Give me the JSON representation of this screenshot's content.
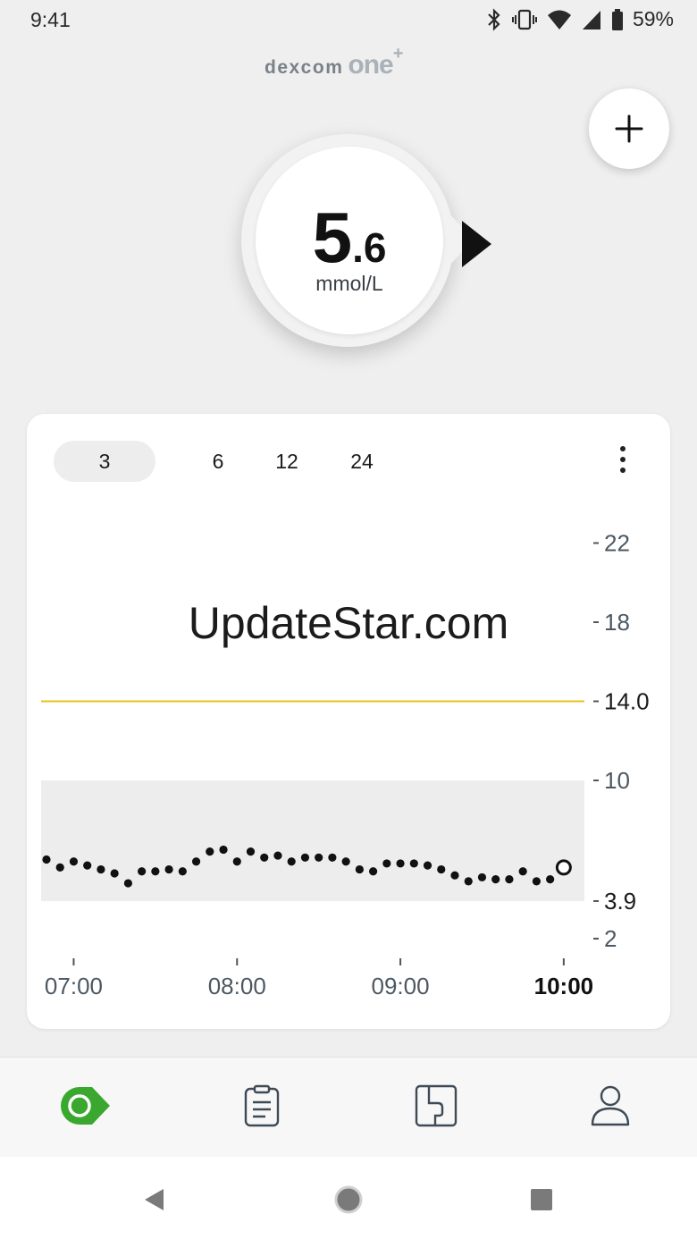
{
  "status_bar": {
    "time": "9:41",
    "battery": "59%",
    "icons": [
      "bluetooth-icon",
      "vibrate-icon",
      "wifi-icon",
      "cell-signal-icon",
      "battery-icon"
    ]
  },
  "logo": {
    "brand": "DEXCOM",
    "product": "one",
    "plus": "+"
  },
  "reading": {
    "integer": "5",
    "decimal": ".6",
    "unit": "mmol/L",
    "trend": "steady-arrow-right"
  },
  "graph": {
    "range_tabs": [
      "3",
      "6",
      "12",
      "24"
    ],
    "selected_range": "3",
    "watermark": "UpdateStar.com"
  },
  "chart_data": {
    "type": "scatter",
    "ylabel": "",
    "xlabel": "",
    "y_tick_labels": [
      "22",
      "18",
      "14.0",
      "10",
      "3.9",
      "2"
    ],
    "x_tick_labels": [
      "07:00",
      "08:00",
      "09:00",
      "10:00"
    ],
    "high_threshold": 14.0,
    "low_threshold": 3.9,
    "target_range": [
      3.9,
      10
    ],
    "xlim": [
      "06:50",
      "10:03"
    ],
    "series": [
      {
        "x": [
          "06:50",
          "06:55",
          "07:00",
          "07:05",
          "07:10",
          "07:15",
          "07:20",
          "07:25",
          "07:30",
          "07:35",
          "07:40",
          "07:45",
          "07:50",
          "07:55",
          "08:00",
          "08:05",
          "08:10",
          "08:15",
          "08:20",
          "08:25",
          "08:30",
          "08:35",
          "08:40",
          "08:45",
          "08:50",
          "08:55",
          "09:00",
          "09:05",
          "09:10",
          "09:15",
          "09:20",
          "09:25",
          "09:30",
          "09:35",
          "09:40",
          "09:45",
          "09:50",
          "09:55",
          "10:00"
        ],
        "y": [
          6.0,
          5.6,
          5.9,
          5.7,
          5.5,
          5.3,
          4.8,
          5.4,
          5.4,
          5.5,
          5.4,
          5.9,
          6.4,
          6.5,
          5.9,
          6.4,
          6.1,
          6.2,
          5.9,
          6.1,
          6.1,
          6.1,
          5.9,
          5.5,
          5.4,
          5.8,
          5.8,
          5.8,
          5.7,
          5.5,
          5.2,
          4.9,
          5.1,
          5.0,
          5.0,
          5.4,
          4.9,
          5.0,
          5.6
        ]
      }
    ]
  },
  "nav": {
    "items": [
      "glucose-tab",
      "events-tab",
      "reports-tab",
      "profile-tab"
    ],
    "active": "glucose-tab"
  },
  "colors": {
    "active_green": "#3aa82e",
    "high_line": "#e8c21b",
    "target_band": "#ededed"
  }
}
